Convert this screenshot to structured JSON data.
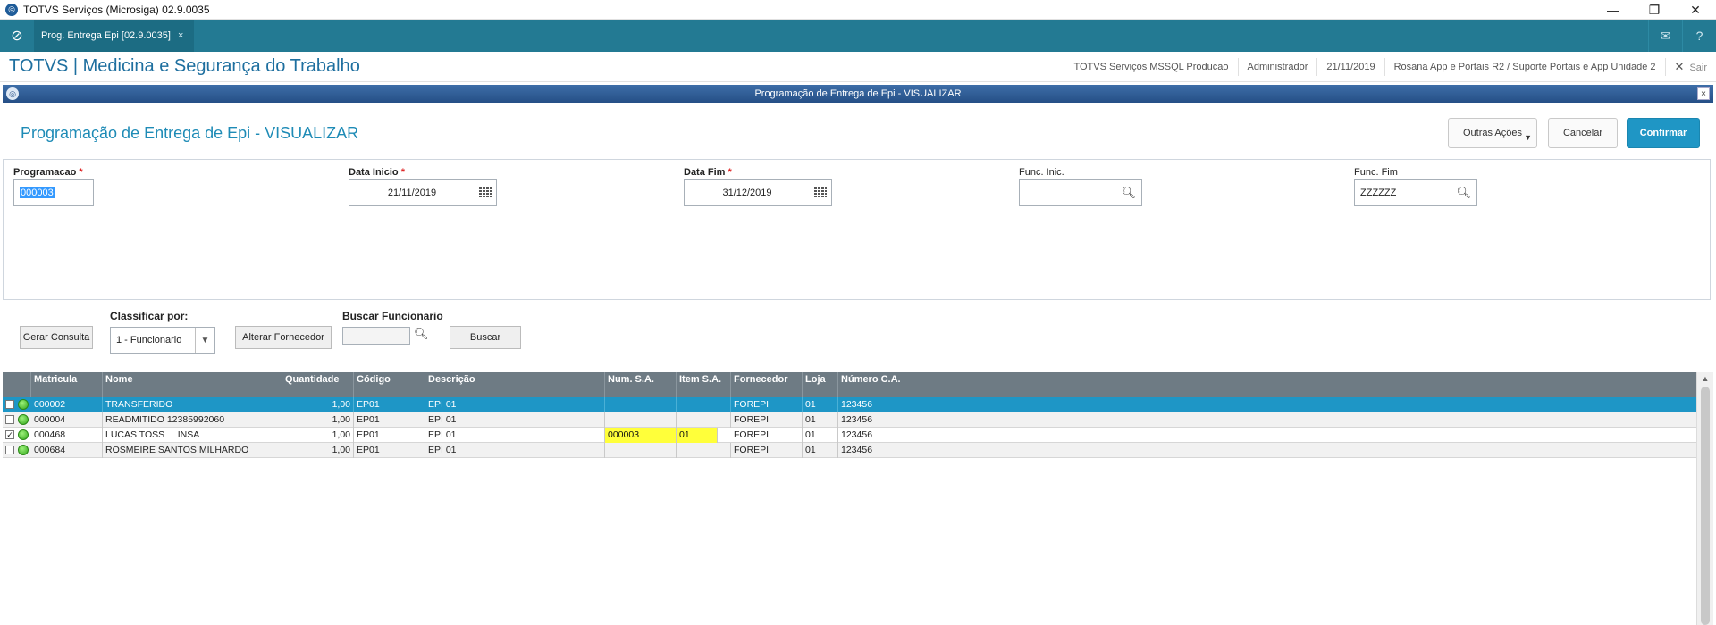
{
  "window": {
    "title": "TOTVS Serviços (Microsiga) 02.9.0035",
    "minimize_glyph": "—",
    "restore_glyph": "❐",
    "close_glyph": "✕"
  },
  "tabbar": {
    "tab_label": "Prog. Entrega Epi [02.9.0035]",
    "tab_close": "×"
  },
  "module": {
    "title": "TOTVS | Medicina e Segurança do Trabalho",
    "environment": "TOTVS Serviços MSSQL Producao",
    "user": "Administrador",
    "date": "21/11/2019",
    "company": "Rosana App e Portais  R2 / Suporte Portais e App Unidade 2",
    "exit_label": "Sair"
  },
  "dialog": {
    "bar_title": "Programação de Entrega de Epi - VISUALIZAR",
    "heading": "Programação de Entrega de Epi - VISUALIZAR",
    "other_actions": "Outras Ações",
    "cancel": "Cancelar",
    "confirm": "Confirmar"
  },
  "filters": {
    "programacao_label": "Programacao",
    "programacao_value": "000003",
    "data_inicio_label": "Data Inicio",
    "data_inicio_value": "21/11/2019",
    "data_fim_label": "Data Fim",
    "data_fim_value": "31/12/2019",
    "func_inic_label": "Func. Inic.",
    "func_inic_value": "",
    "func_fim_label": "Func. Fim",
    "func_fim_value": "ZZZZZZ",
    "required_mark": "*"
  },
  "toolbar": {
    "gerar_consulta": "Gerar Consulta",
    "classificar_label": "Classificar por:",
    "classificar_value": "1 - Funcionario",
    "alterar_fornecedor": "Alterar Fornecedor",
    "buscar_funcionario_label": "Buscar Funcionario",
    "buscar_button": "Buscar"
  },
  "grid": {
    "columns": [
      "Matricula",
      "Nome",
      "Quantidade",
      "Código",
      "Descrição",
      "Num. S.A.",
      "Item S.A.",
      "Fornecedor",
      "Loja",
      "Número C.A."
    ],
    "rows": [
      {
        "checked": false,
        "status": "green",
        "matricula": "000002",
        "nome": "TRANSFERIDO",
        "quantidade": "1,00",
        "codigo": "EP01",
        "descricao": "EPI 01",
        "num_sa": "",
        "item_sa": "",
        "fornecedor": "FOREPI",
        "loja": "01",
        "numero_ca": "123456"
      },
      {
        "checked": false,
        "status": "green",
        "matricula": "000004",
        "nome": "READMITIDO 12385992060",
        "quantidade": "1,00",
        "codigo": "EP01",
        "descricao": "EPI 01",
        "num_sa": "",
        "item_sa": "",
        "fornecedor": "FOREPI",
        "loja": "01",
        "numero_ca": "123456"
      },
      {
        "checked": true,
        "status": "green",
        "matricula": "000468",
        "nome": "LUCAS TOSS     INSA",
        "quantidade": "1,00",
        "codigo": "EP01",
        "descricao": "EPI 01",
        "num_sa": "000003",
        "item_sa": "01",
        "fornecedor": "FOREPI",
        "loja": "01",
        "numero_ca": "123456"
      },
      {
        "checked": false,
        "status": "green",
        "matricula": "000684",
        "nome": "ROSMEIRE SANTOS MILHARDO",
        "quantidade": "1,00",
        "codigo": "EP01",
        "descricao": "EPI 01",
        "num_sa": "",
        "item_sa": "",
        "fornecedor": "FOREPI",
        "loja": "01",
        "numero_ca": "123456"
      }
    ]
  },
  "colors": {
    "tabbar": "#237a93",
    "dialog_bar": "#2e5d98",
    "accent": "#1e96c6",
    "header": "#6e7b84",
    "highlight": "#ffff3a",
    "status_ok": "#34a81c"
  }
}
